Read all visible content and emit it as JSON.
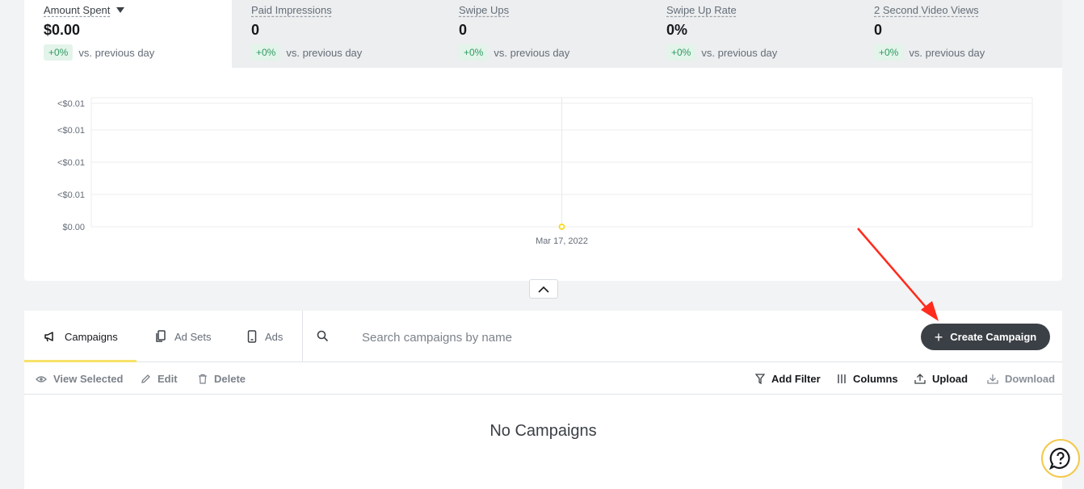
{
  "metrics": [
    {
      "label": "Amount Spent",
      "value": "$0.00",
      "delta": "+0%",
      "compare": "vs. previous day",
      "active": true
    },
    {
      "label": "Paid Impressions",
      "value": "0",
      "delta": "+0%",
      "compare": "vs. previous day"
    },
    {
      "label": "Swipe Ups",
      "value": "0",
      "delta": "+0%",
      "compare": "vs. previous day"
    },
    {
      "label": "Swipe Up Rate",
      "value": "0%",
      "delta": "+0%",
      "compare": "vs. previous day"
    },
    {
      "label": "2 Second Video Views",
      "value": "0",
      "delta": "+0%",
      "compare": "vs. previous day"
    }
  ],
  "chart_data": {
    "type": "line",
    "x": [
      "Mar 17, 2022"
    ],
    "series": [
      {
        "values": [
          0
        ]
      }
    ],
    "y_tick_labels": [
      "<$0.01",
      "<$0.01",
      "<$0.01",
      "<$0.01",
      "$0.00"
    ],
    "marker_color": "#f7d91a",
    "grid": true
  },
  "tabs": [
    {
      "label": "Campaigns",
      "icon": "megaphone-icon"
    },
    {
      "label": "Ad Sets",
      "icon": "copy-icon"
    },
    {
      "label": "Ads",
      "icon": "phone-icon"
    }
  ],
  "search": {
    "placeholder": "Search campaigns by name"
  },
  "create_button": {
    "label": "Create Campaign"
  },
  "toolbar": {
    "view_selected": "View Selected",
    "edit": "Edit",
    "delete": "Delete",
    "add_filter": "Add Filter",
    "columns": "Columns",
    "upload": "Upload",
    "download": "Download"
  },
  "empty_state": "No Campaigns",
  "colors": {
    "accent": "#f7e16a",
    "annotation_arrow": "#ff2b1c",
    "delta_green": "#2e9a62"
  }
}
